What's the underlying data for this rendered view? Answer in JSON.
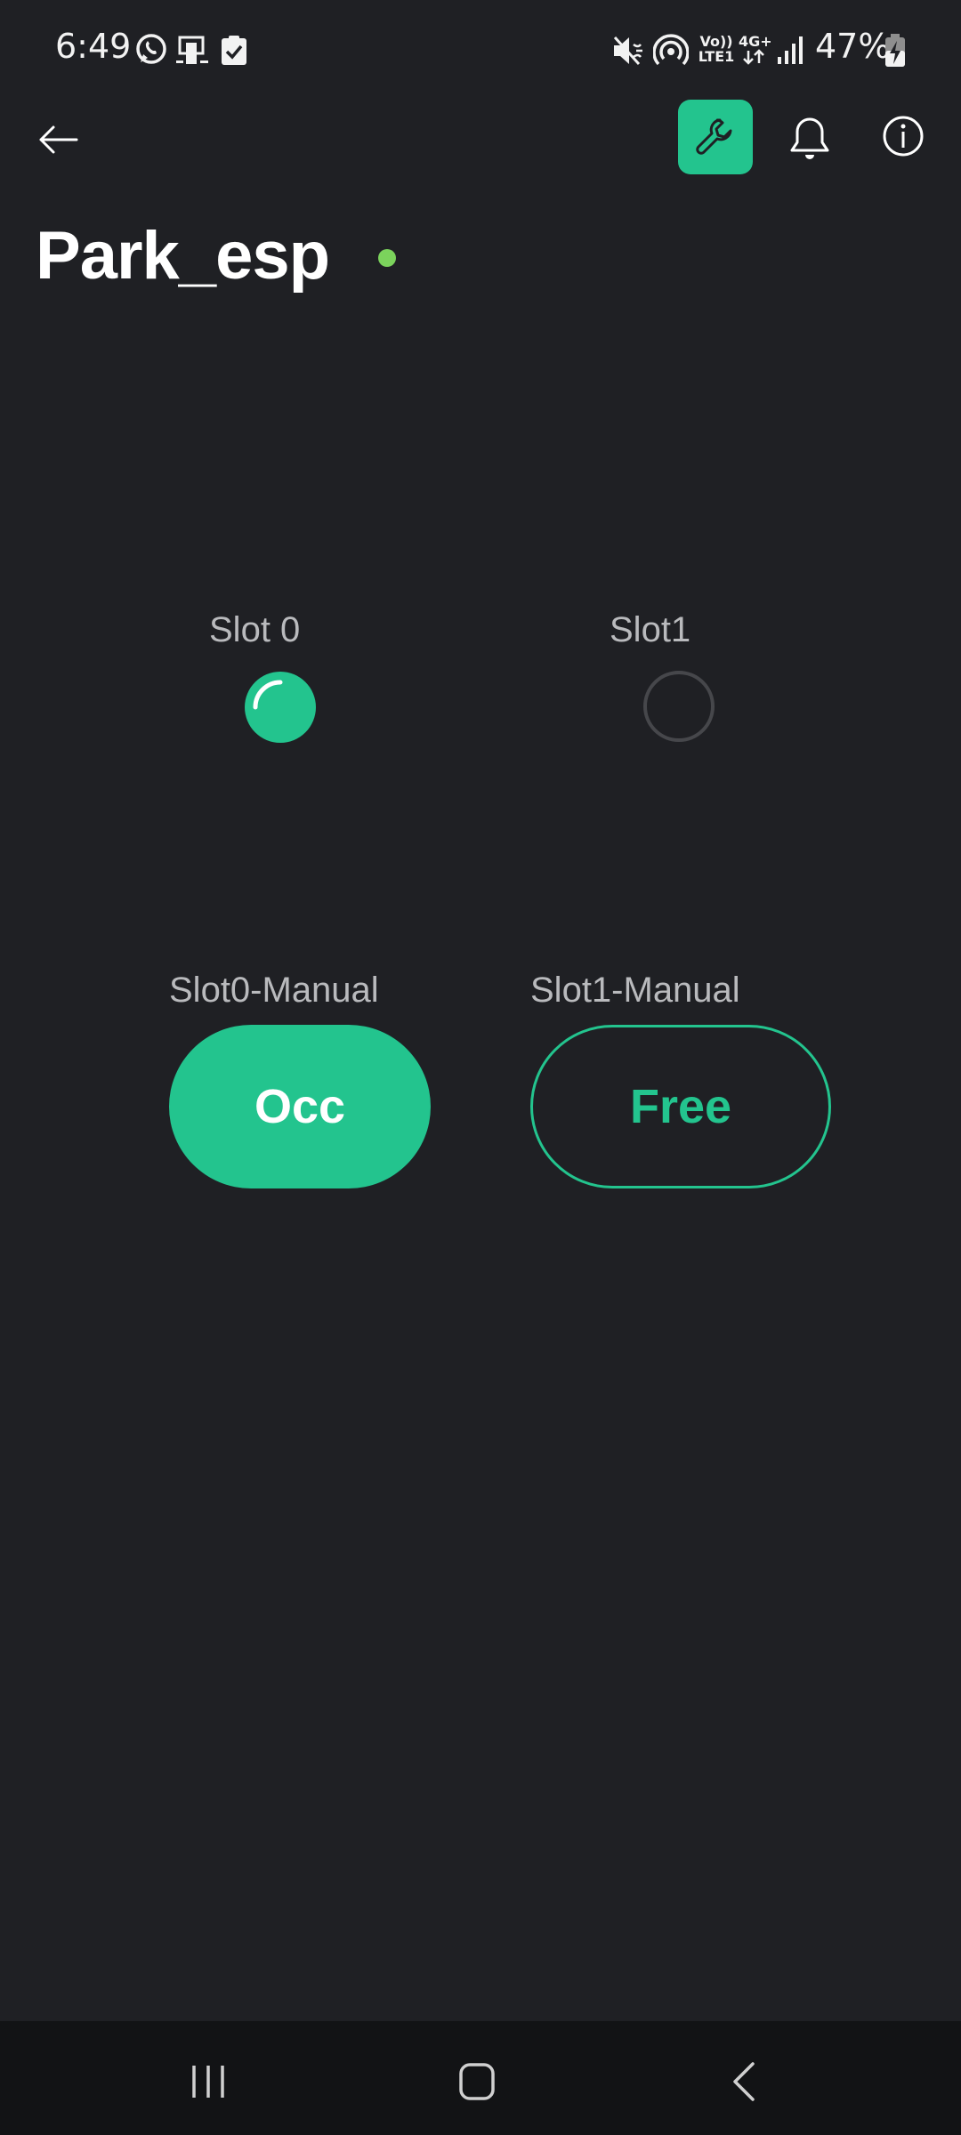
{
  "status_bar": {
    "time": "6:49",
    "battery": "47%",
    "left_icons": [
      "whatsapp-icon",
      "screen-mirror-icon",
      "task-check-icon"
    ],
    "right_icons": [
      "mute-icon",
      "hotspot-icon",
      "volte-icon",
      "4g-plus-icon",
      "signal-icon",
      "battery-charging-icon"
    ],
    "volte_label_top": "Vo))",
    "volte_label_bottom": "LTE1",
    "net_label": "4G+"
  },
  "app_bar": {
    "back_icon": "arrow-left-icon",
    "tool_icon": "wrench-icon",
    "bell_icon": "bell-icon",
    "info_icon": "info-icon",
    "accent_color": "#23c48e"
  },
  "device": {
    "name": "Park_esp",
    "status_color": "#7bd35c"
  },
  "widgets": {
    "slot0": {
      "label": "Slot 0",
      "state": "on"
    },
    "slot1": {
      "label": "Slot1",
      "state": "off"
    },
    "slot0_manual": {
      "label": "Slot0-Manual",
      "button_text": "Occ",
      "state": "on"
    },
    "slot1_manual": {
      "label": "Slot1-Manual",
      "button_text": "Free",
      "state": "off"
    }
  },
  "nav_bar": {
    "icons": [
      "recent-apps-icon",
      "home-icon",
      "nav-back-icon"
    ]
  },
  "colors": {
    "background": "#1f2024",
    "label": "#b9babd",
    "navbar": "#121315"
  }
}
